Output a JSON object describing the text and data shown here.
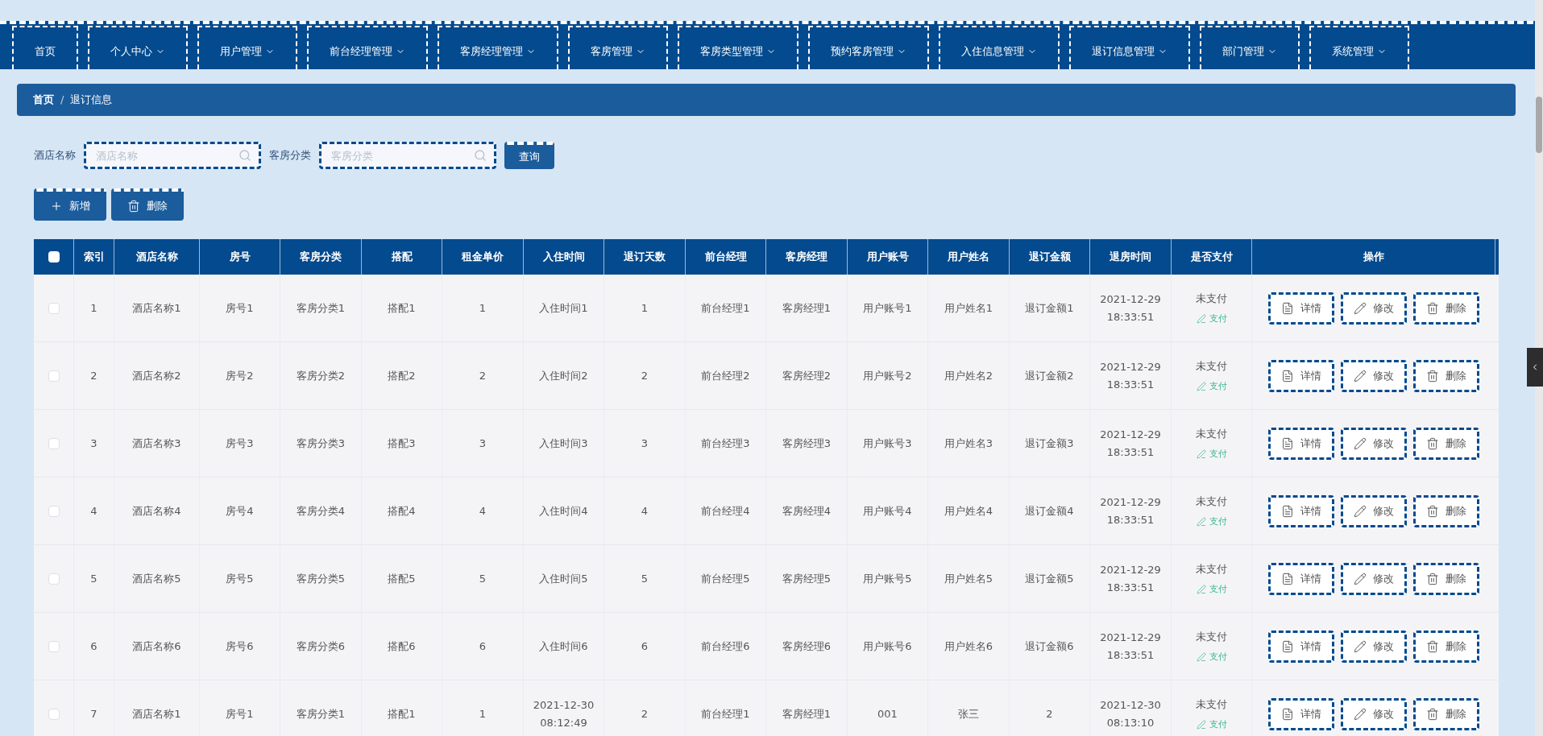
{
  "nav": [
    {
      "label": "首页",
      "dropdown": false
    },
    {
      "label": "个人中心",
      "dropdown": true
    },
    {
      "label": "用户管理",
      "dropdown": true
    },
    {
      "label": "前台经理管理",
      "dropdown": true
    },
    {
      "label": "客房经理管理",
      "dropdown": true
    },
    {
      "label": "客房管理",
      "dropdown": true
    },
    {
      "label": "客房类型管理",
      "dropdown": true
    },
    {
      "label": "预约客房管理",
      "dropdown": true
    },
    {
      "label": "入住信息管理",
      "dropdown": true
    },
    {
      "label": "退订信息管理",
      "dropdown": true
    },
    {
      "label": "部门管理",
      "dropdown": true
    },
    {
      "label": "系统管理",
      "dropdown": true
    }
  ],
  "breadcrumb": {
    "items": [
      "首页",
      "退订信息"
    ],
    "separator": "/"
  },
  "search": {
    "fields": [
      {
        "label": "酒店名称",
        "placeholder": "酒店名称"
      },
      {
        "label": "客房分类",
        "placeholder": "客房分类"
      }
    ],
    "button": "查询"
  },
  "actions": [
    {
      "kind": "add",
      "label": "新增"
    },
    {
      "kind": "delete",
      "label": "删除"
    }
  ],
  "table": {
    "select_all_checked": false,
    "columns": [
      "索引",
      "酒店名称",
      "房号",
      "客房分类",
      "搭配",
      "租金单价",
      "入住时间",
      "退订天数",
      "前台经理",
      "客房经理",
      "用户账号",
      "用户姓名",
      "退订金额",
      "退房时间",
      "是否支付",
      "操作"
    ],
    "rows": [
      {
        "checked": false,
        "cells": [
          "1",
          "酒店名称1",
          "房号1",
          "客房分类1",
          "搭配1",
          "1",
          "入住时间1",
          "1",
          "前台经理1",
          "客房经理1",
          "用户账号1",
          "用户姓名1",
          "退订金额1",
          "2021-12-29 18:33:51"
        ],
        "paid_status": "未支付",
        "pay_link": "支付",
        "buttons": [
          {
            "kind": "detail",
            "label": "详情"
          },
          {
            "kind": "edit",
            "label": "修改"
          },
          {
            "kind": "delete",
            "label": "删除"
          }
        ]
      },
      {
        "checked": false,
        "cells": [
          "2",
          "酒店名称2",
          "房号2",
          "客房分类2",
          "搭配2",
          "2",
          "入住时间2",
          "2",
          "前台经理2",
          "客房经理2",
          "用户账号2",
          "用户姓名2",
          "退订金额2",
          "2021-12-29 18:33:51"
        ],
        "paid_status": "未支付",
        "pay_link": "支付",
        "buttons": [
          {
            "kind": "detail",
            "label": "详情"
          },
          {
            "kind": "edit",
            "label": "修改"
          },
          {
            "kind": "delete",
            "label": "删除"
          }
        ]
      },
      {
        "checked": false,
        "cells": [
          "3",
          "酒店名称3",
          "房号3",
          "客房分类3",
          "搭配3",
          "3",
          "入住时间3",
          "3",
          "前台经理3",
          "客房经理3",
          "用户账号3",
          "用户姓名3",
          "退订金额3",
          "2021-12-29 18:33:51"
        ],
        "paid_status": "未支付",
        "pay_link": "支付",
        "buttons": [
          {
            "kind": "detail",
            "label": "详情"
          },
          {
            "kind": "edit",
            "label": "修改"
          },
          {
            "kind": "delete",
            "label": "删除"
          }
        ]
      },
      {
        "checked": false,
        "cells": [
          "4",
          "酒店名称4",
          "房号4",
          "客房分类4",
          "搭配4",
          "4",
          "入住时间4",
          "4",
          "前台经理4",
          "客房经理4",
          "用户账号4",
          "用户姓名4",
          "退订金额4",
          "2021-12-29 18:33:51"
        ],
        "paid_status": "未支付",
        "pay_link": "支付",
        "buttons": [
          {
            "kind": "detail",
            "label": "详情"
          },
          {
            "kind": "edit",
            "label": "修改"
          },
          {
            "kind": "delete",
            "label": "删除"
          }
        ]
      },
      {
        "checked": false,
        "cells": [
          "5",
          "酒店名称5",
          "房号5",
          "客房分类5",
          "搭配5",
          "5",
          "入住时间5",
          "5",
          "前台经理5",
          "客房经理5",
          "用户账号5",
          "用户姓名5",
          "退订金额5",
          "2021-12-29 18:33:51"
        ],
        "paid_status": "未支付",
        "pay_link": "支付",
        "buttons": [
          {
            "kind": "detail",
            "label": "详情"
          },
          {
            "kind": "edit",
            "label": "修改"
          },
          {
            "kind": "delete",
            "label": "删除"
          }
        ]
      },
      {
        "checked": false,
        "cells": [
          "6",
          "酒店名称6",
          "房号6",
          "客房分类6",
          "搭配6",
          "6",
          "入住时间6",
          "6",
          "前台经理6",
          "客房经理6",
          "用户账号6",
          "用户姓名6",
          "退订金额6",
          "2021-12-29 18:33:51"
        ],
        "paid_status": "未支付",
        "pay_link": "支付",
        "buttons": [
          {
            "kind": "detail",
            "label": "详情"
          },
          {
            "kind": "edit",
            "label": "修改"
          },
          {
            "kind": "delete",
            "label": "删除"
          }
        ]
      },
      {
        "checked": false,
        "cells": [
          "7",
          "酒店名称1",
          "房号1",
          "客房分类1",
          "搭配1",
          "1",
          "2021-12-30 08:12:49",
          "2",
          "前台经理1",
          "客房经理1",
          "001",
          "张三",
          "2",
          "2021-12-30 08:13:10"
        ],
        "paid_status": "未支付",
        "pay_link": "支付",
        "buttons": [
          {
            "kind": "detail",
            "label": "详情"
          },
          {
            "kind": "edit",
            "label": "修改"
          },
          {
            "kind": "delete",
            "label": "删除"
          }
        ]
      }
    ]
  }
}
